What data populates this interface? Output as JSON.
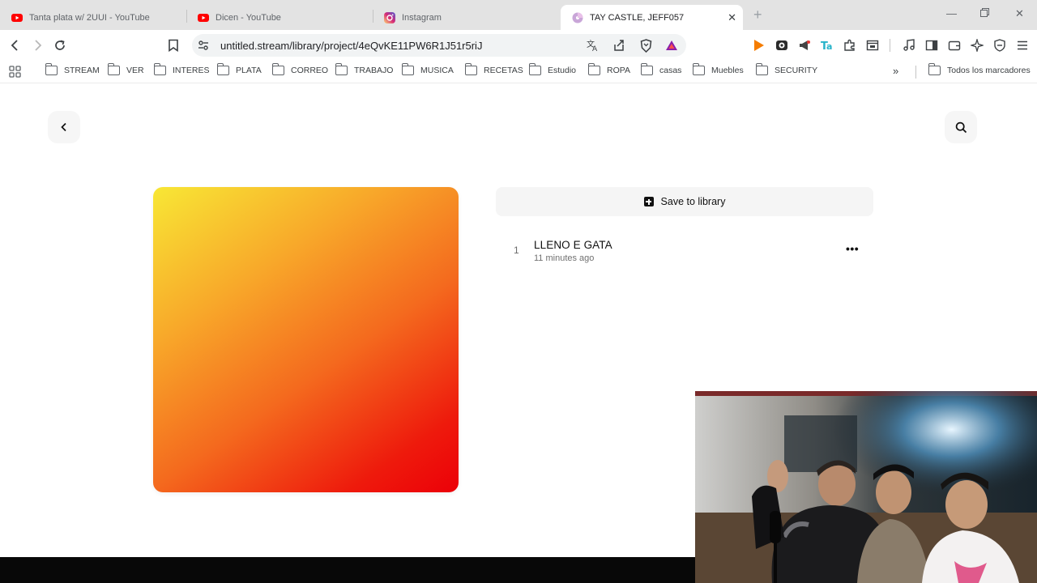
{
  "tabs": [
    {
      "title": "Tanta plata w/ 2UUI - YouTube",
      "icon": "youtube-icon",
      "active": false
    },
    {
      "title": "Dicen - YouTube",
      "icon": "youtube-icon",
      "active": false
    },
    {
      "title": "Instagram",
      "icon": "instagram-icon",
      "active": false
    },
    {
      "title": "TAY CASTLE, JEFF057",
      "icon": "stream-disc-icon",
      "active": true
    }
  ],
  "address_bar": {
    "url": "untitled.stream/library/project/4eQvKE11PW6R1J51r5riJ"
  },
  "bookmarks": {
    "items": [
      "STREAM",
      "VER",
      "INTERES",
      "PLATA",
      "CORREO",
      "TRABAJO",
      "MUSICA",
      "RECETAS",
      "Estudio",
      "ROPA",
      "casas",
      "Muebles",
      "SECURITY"
    ],
    "all_label": "Todos los marcadores"
  },
  "colors": {
    "cover_gradient": [
      "#f8e735",
      "#f8a92a",
      "#f46a1e",
      "#ee1a0c",
      "#ec0008"
    ],
    "youtube_red": "#ff0000",
    "brave_orange": "#fb542b"
  },
  "project": {
    "save_label": "Save to library",
    "tracks": [
      {
        "number": "1",
        "title": "LLENO E GATA",
        "time": "11 minutes ago"
      }
    ]
  }
}
